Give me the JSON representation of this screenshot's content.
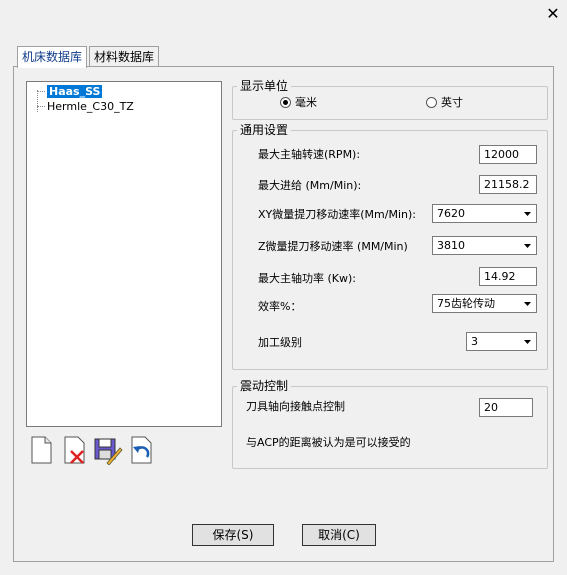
{
  "window": {
    "close_glyph": "✕"
  },
  "tabs": [
    {
      "label": "机床数据库"
    },
    {
      "label": "材料数据库"
    }
  ],
  "tree": {
    "items": [
      {
        "label": "Haas_SS"
      },
      {
        "label": "Hermle_C30_TZ"
      }
    ]
  },
  "display_units": {
    "title": "显示单位",
    "options": [
      {
        "label": "毫米"
      },
      {
        "label": "英寸"
      }
    ],
    "selected": "毫米"
  },
  "general": {
    "title": "通用设置",
    "max_spindle_speed": {
      "label": "最大主轴转速(RPM):",
      "value": "12000"
    },
    "max_feed": {
      "label": "最大进给 (Mm/Min):",
      "value": "21158.2"
    },
    "xy_rate": {
      "label": "XY微量提刀移动速率(Mm/Min):",
      "value": "7620"
    },
    "z_rate": {
      "label": "Z微量提刀移动速率 (MM/Min)",
      "value": "3810"
    },
    "max_power": {
      "label": "最大主轴功率 (Kw):",
      "value": "14.92"
    },
    "efficiency": {
      "label": "效率%：",
      "value": "75齿轮传动"
    },
    "machining_level": {
      "label": "加工级别",
      "value": "3"
    }
  },
  "vibration": {
    "title": "震动控制",
    "contact_label": "刀具轴向接触点控制",
    "contact_value": "20",
    "note": "与ACP的距离被认为是可以接受的"
  },
  "toolbar_icons": [
    "new-file-icon",
    "delete-icon",
    "save-edit-icon",
    "undo-icon"
  ],
  "buttons": {
    "save": "保存(S)",
    "cancel": "取消(C)"
  },
  "colors": {
    "selection": "#0078d7",
    "background": "#f0f0f0"
  }
}
